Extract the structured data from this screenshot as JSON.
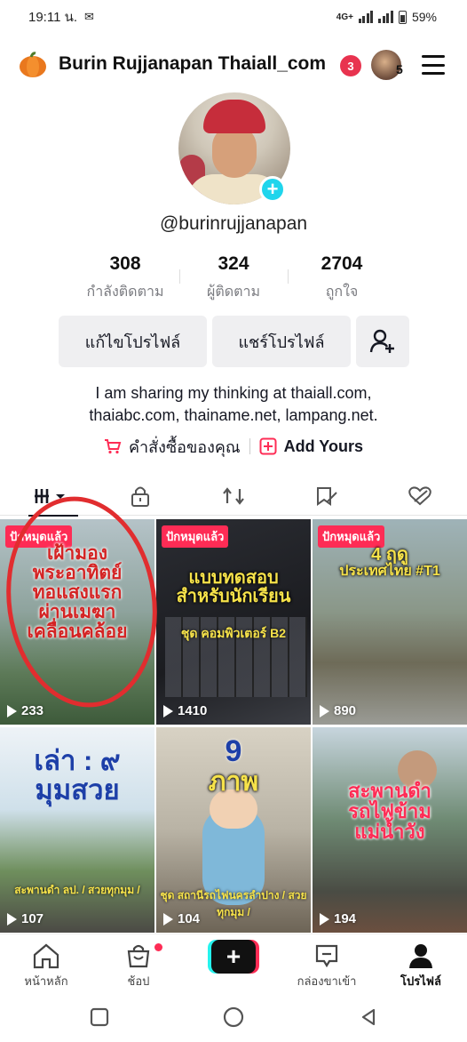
{
  "status_bar": {
    "time": "19:11 น.",
    "network": "4G+",
    "battery": "59%"
  },
  "header": {
    "title": "Burin Rujjanapan Thaiall_com",
    "notification_count": "3",
    "friends_count": "5"
  },
  "profile": {
    "username": "@burinrujjanapan",
    "stats": [
      {
        "value": "308",
        "label": "กำลังติดตาม"
      },
      {
        "value": "324",
        "label": "ผู้ติดตาม"
      },
      {
        "value": "2704",
        "label": "ถูกใจ"
      }
    ],
    "edit_label": "แก้ไขโปรไฟล์",
    "share_label": "แชร์โปรไฟล์",
    "bio_line1": "I am sharing my thinking at thaiall.com,",
    "bio_line2": "thaiabc.com, thainame.net, lampang.net.",
    "orders_label": "คำสั่งซื้อของคุณ",
    "add_yours_label": "Add Yours"
  },
  "videos": [
    {
      "pinned": "ปักหมุดแล้ว",
      "views": "233",
      "title_lines": [
        "เฝ้ามอง",
        "พระอาทิตย์",
        "ทอแสงแรก",
        "ผ่านเมฆา",
        "เคลื่อนคล้อย"
      ]
    },
    {
      "pinned": "ปักหมุดแล้ว",
      "views": "1410",
      "title_lines": [
        "แบบทดสอบ",
        "สำหรับนักเรียน"
      ],
      "caption": "ชุด คอมพิวเตอร์ B2"
    },
    {
      "pinned": "ปักหมุดแล้ว",
      "views": "890",
      "title_lines": [
        "4 ฤดู",
        "ประเทศไทย #T1"
      ]
    },
    {
      "views": "107",
      "title_lines": [
        "เล่า : ๙",
        "มุมสวย"
      ],
      "caption": "สะพานดำ ลป. / สวยทุกมุม /"
    },
    {
      "views": "104",
      "title_lines": [
        "9",
        "ภาพ"
      ],
      "caption": "ชุด สถานีรถไฟนครลำปาง / สวยทุกมุม /"
    },
    {
      "views": "194",
      "title_lines": [
        "สะพานดำ",
        "รถไฟข้าม",
        "แม่น้ำวัง"
      ]
    }
  ],
  "bottom_nav": {
    "home": "หน้าหลัก",
    "shop": "ช้อป",
    "inbox": "กล่องขาเข้า",
    "profile": "โปรไฟล์"
  },
  "colors": {
    "accent": "#fe2c55",
    "teal": "#20d5ec",
    "annotation_circle": "#e12d2f"
  },
  "icons": {
    "tabs": [
      "videos-grid-icon",
      "lock-icon",
      "repost-icon",
      "saved-icon",
      "liked-icon"
    ]
  }
}
